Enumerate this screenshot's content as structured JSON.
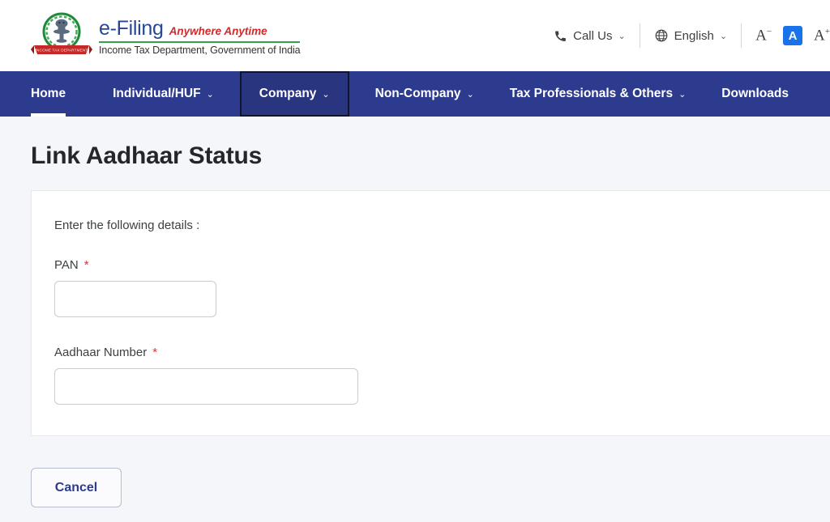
{
  "header": {
    "logo": {
      "emblem_name": "income-tax-department-emblem",
      "ribbon_text": "INCOME TAX DEPARTMENT",
      "efiling": "e-Filing",
      "tagline": "Anywhere Anytime",
      "department": "Income Tax Department, Government of India"
    },
    "call_us": {
      "label": "Call Us",
      "icon": "phone-icon",
      "chevron": "⌄"
    },
    "language": {
      "label": "English",
      "icon": "globe-icon",
      "chevron": "⌄"
    },
    "font_size": {
      "decrease": "A",
      "decrease_sup": "−",
      "normal": "A",
      "increase": "A",
      "increase_sup": "+",
      "active_color": "#1a73e8"
    }
  },
  "nav": {
    "background_color": "#2c3b8e",
    "items": [
      {
        "label": "Home",
        "chevron": "",
        "state": "active"
      },
      {
        "label": "Individual/HUF",
        "chevron": "⌄",
        "state": "normal"
      },
      {
        "label": "Company",
        "chevron": "⌄",
        "state": "focused"
      },
      {
        "label": "Non-Company",
        "chevron": "⌄",
        "state": "normal"
      },
      {
        "label": "Tax Professionals & Others",
        "chevron": "⌄",
        "state": "normal"
      },
      {
        "label": "Downloads",
        "chevron": "",
        "state": "normal"
      }
    ]
  },
  "main": {
    "page_title": "Link Aadhaar Status",
    "card": {
      "intro": "Enter the following details :",
      "fields": [
        {
          "label": "PAN",
          "required_mark": "*",
          "value": "",
          "placeholder": ""
        },
        {
          "label": "Aadhaar Number",
          "required_mark": "*",
          "value": "",
          "placeholder": ""
        }
      ]
    },
    "cancel_button": "Cancel"
  }
}
